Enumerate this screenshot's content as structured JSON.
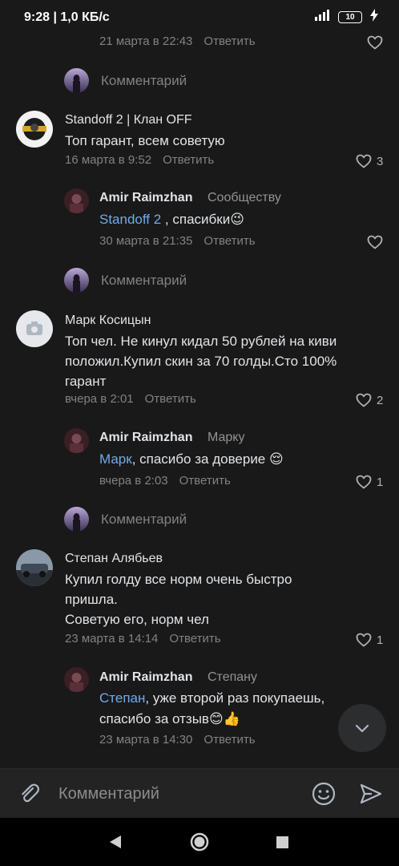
{
  "status": {
    "time": "9:28 | 1,0 КБ/с",
    "battery": "10"
  },
  "thread": {
    "top_reply_meta": {
      "date": "21 марта в 22:43",
      "reply": "Ответить"
    },
    "compose_label": "Комментарий",
    "comments": [
      {
        "author": "Standoff 2 | Клан OFF",
        "text": "Топ гарант, всем советую",
        "date": "16 марта в 9:52",
        "reply": "Ответить",
        "likes": "3",
        "answer": {
          "author": "Amir Raimzhan",
          "to": "Сообществу",
          "mention": "Standoff 2",
          "text": " , спасибки",
          "emoji": "😉",
          "date": "30 марта в 21:35",
          "reply": "Ответить"
        }
      },
      {
        "author": "Марк Косицын",
        "text_lines": [
          "Топ чел. Не кинул кидал 50 рублей на киви",
          "положил.Купил скин за 70 голды.Сто 100%",
          "гарант"
        ],
        "date": "вчера в 2:01",
        "reply": "Ответить",
        "likes": "2",
        "answer": {
          "author": "Amir Raimzhan",
          "to": "Марку",
          "mention": "Марк",
          "text": ", спасибо за доверие",
          "emoji": "😌",
          "date": "вчера в 2:03",
          "reply": "Ответить",
          "likes": "1"
        }
      },
      {
        "author": "Степан Алябьев",
        "text_lines": [
          "Купил голду все норм очень быстро",
          "пришла.",
          "Советую его, норм чел"
        ],
        "date": "23 марта в 14:14",
        "reply": "Ответить",
        "likes": "1",
        "answer": {
          "author": "Amir Raimzhan",
          "to": "Степану",
          "mention": "Степан",
          "text_line1": ", уже второй раз покупаешь,",
          "text_line2": "спасибо за отзыв",
          "emoji": "😊👍",
          "date": "23 марта в 14:30",
          "reply": "Ответить"
        }
      }
    ]
  },
  "input": {
    "placeholder": "Комментарий"
  },
  "icons": {
    "accent": "#71aaeb",
    "background": "#191919"
  }
}
